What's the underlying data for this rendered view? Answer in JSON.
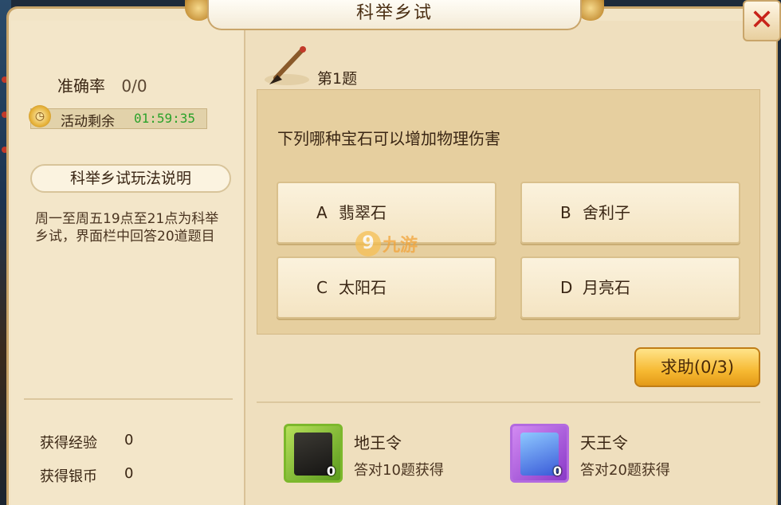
{
  "window": {
    "title": "科举乡试"
  },
  "left": {
    "accuracy_label": "准确率",
    "accuracy_value": "0/0",
    "timer_label": "活动剩余",
    "timer_value": "01:59:35",
    "rules_title": "科举乡试玩法说明",
    "rules_text": "周一至周五19点至21点为科举乡试，界面栏中回答20道题目",
    "exp_label": "获得经验",
    "exp_value": "0",
    "silver_label": "获得银币",
    "silver_value": "0"
  },
  "question": {
    "number_label": "第1题",
    "text": "下列哪种宝石可以增加物理伤害",
    "options": [
      {
        "letter": "A",
        "text": "翡翠石"
      },
      {
        "letter": "B",
        "text": "舍利子"
      },
      {
        "letter": "C",
        "text": "太阳石"
      },
      {
        "letter": "D",
        "text": "月亮石"
      }
    ]
  },
  "help_button": "求助(0/3)",
  "rewards": [
    {
      "name": "地王令",
      "desc": "答对10题获得",
      "count": "0",
      "icon": "dark-scroll-icon",
      "frame_color": "#7cb82c"
    },
    {
      "name": "天王令",
      "desc": "答对20题获得",
      "count": "0",
      "icon": "blue-scroll-icon",
      "frame_color": "#b36ae0"
    }
  ],
  "watermark": {
    "digit": "9",
    "text": "九游"
  },
  "colors": {
    "timer_green": "#2aa22a",
    "close_red": "#c8231a",
    "help_gold": "#f6b932"
  }
}
